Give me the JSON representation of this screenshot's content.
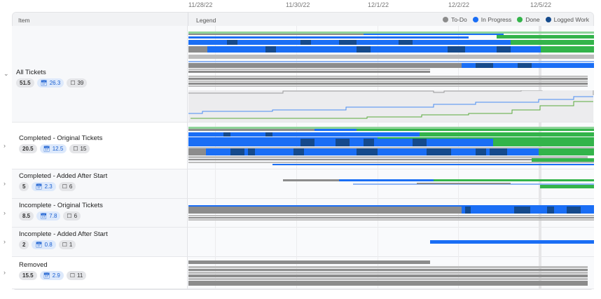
{
  "timeline": {
    "dates": [
      "11/28/22",
      "11/30/22",
      "12/1/22",
      "12/2/22",
      "12/5/22"
    ]
  },
  "header": {
    "item": "Item",
    "legend": "Legend"
  },
  "legend": [
    {
      "label": "To-Do",
      "color": "#8c8c8c"
    },
    {
      "label": "In Progress",
      "color": "#1a6ef5"
    },
    {
      "label": "Done",
      "color": "#33b44a"
    },
    {
      "label": "Logged Work",
      "color": "#154a8c"
    }
  ],
  "rows": [
    {
      "title": "All Tickets",
      "points": "51.5",
      "logged": "26.3",
      "tickets": "39",
      "expanded": true
    },
    {
      "title": "Completed - Original Tickets",
      "points": "20.5",
      "logged": "12.5",
      "tickets": "15"
    },
    {
      "title": "Completed - Added After Start",
      "points": "5",
      "logged": "2.3",
      "tickets": "6"
    },
    {
      "title": "Incomplete - Original Tickets",
      "points": "8.5",
      "logged": "7.8",
      "tickets": "6"
    },
    {
      "title": "Incomplete - Added After Start",
      "points": "2",
      "logged": "0.8",
      "tickets": "1"
    },
    {
      "title": "Removed",
      "points": "15.5",
      "logged": "2.9",
      "tickets": "11"
    }
  ]
}
